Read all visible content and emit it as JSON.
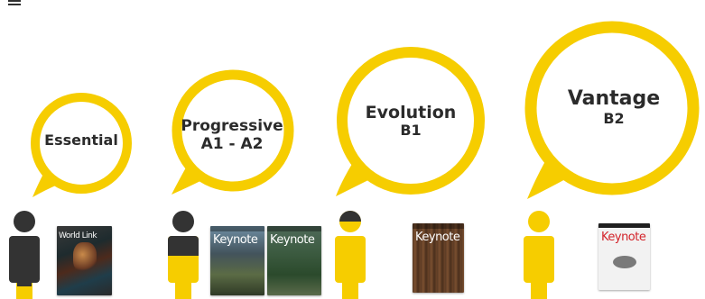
{
  "levels": [
    {
      "name": "Essential",
      "level": ""
    },
    {
      "name": "Progressive",
      "level": "A1 - A2"
    },
    {
      "name": "Evolution",
      "level": "B1"
    },
    {
      "name": "Vantage",
      "level": "B2"
    }
  ],
  "books": [
    {
      "title": "World Link"
    },
    {
      "title": "Keynote"
    },
    {
      "title": "Keynote"
    },
    {
      "title": "Keynote"
    },
    {
      "title": "Keynote"
    }
  ],
  "colors": {
    "accent": "#f6cd00",
    "figure": "#333333",
    "text": "#2b2b2b",
    "bubble_shadow": "#e5e5e5"
  },
  "icons": {
    "menu": "hamburger-menu-icon"
  }
}
